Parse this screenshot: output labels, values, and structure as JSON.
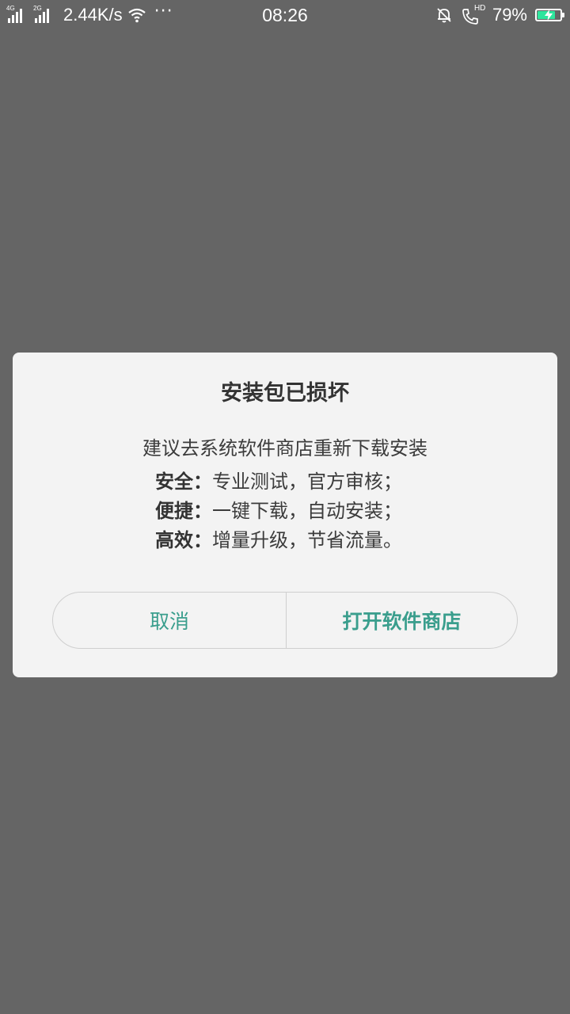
{
  "status_bar": {
    "sim1_label": "4G",
    "sim2_label": "2G",
    "network_speed": "2.44K/s",
    "more_indicator": "···",
    "time": "08:26",
    "call_badge": "HD",
    "battery_percent_text": "79%",
    "battery_level": 0.79,
    "battery_charging": true,
    "icons": [
      "signal-icon",
      "wifi-icon",
      "more-icon",
      "bell-off-icon",
      "hd-call-icon",
      "battery-charging-icon"
    ],
    "battery_fill_color": "#2ee59d"
  },
  "dialog": {
    "title": "安装包已损坏",
    "message": "建议去系统软件商店重新下载安装",
    "features": [
      {
        "key": "安全：",
        "value": "专业测试，官方审核；"
      },
      {
        "key": "便捷：",
        "value": "一键下载，自动安装；"
      },
      {
        "key": "高效：",
        "value": "增量升级，节省流量。"
      }
    ],
    "cancel_label": "取消",
    "confirm_label": "打开软件商店",
    "accent_color": "#3a9e8d"
  },
  "colors": {
    "overlay_background": "#656565",
    "dialog_background": "#f3f3f3"
  }
}
